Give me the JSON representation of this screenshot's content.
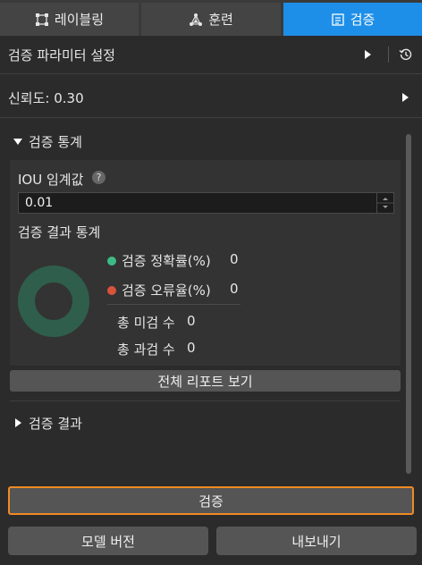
{
  "tabs": [
    {
      "label": "레이블링",
      "icon": "label-box-icon",
      "active": false
    },
    {
      "label": "훈련",
      "icon": "network-icon",
      "active": false
    },
    {
      "label": "검증",
      "icon": "document-icon",
      "active": true
    }
  ],
  "param_section": {
    "title": "검증 파라미터 설정"
  },
  "confidence": {
    "label": "신뢰도: 0.30"
  },
  "stats_section": {
    "title": "검증 통계",
    "iou_label": "IOU 임계값",
    "iou_value": "0.01",
    "help_glyph": "?",
    "result_stats_title": "검증 결과 통계",
    "accuracy_label": "검증 정확률(%)",
    "accuracy_value": "0",
    "error_label": "검증 오류율(%)",
    "error_value": "0",
    "missed_label": "총 미검 수",
    "missed_value": "0",
    "over_label": "총 과검 수",
    "over_value": "0",
    "report_button": "전체 리포트 보기"
  },
  "results_section": {
    "title": "검증 결과"
  },
  "actions": {
    "verify": "검증",
    "model_version": "모델 버전",
    "export": "내보내기"
  },
  "colors": {
    "accent_blue": "#1e8fe8",
    "highlight_orange": "#f08a24",
    "accuracy_green": "#3dbb85",
    "error_red": "#d9533b",
    "donut_green": "#2f5e4c"
  }
}
